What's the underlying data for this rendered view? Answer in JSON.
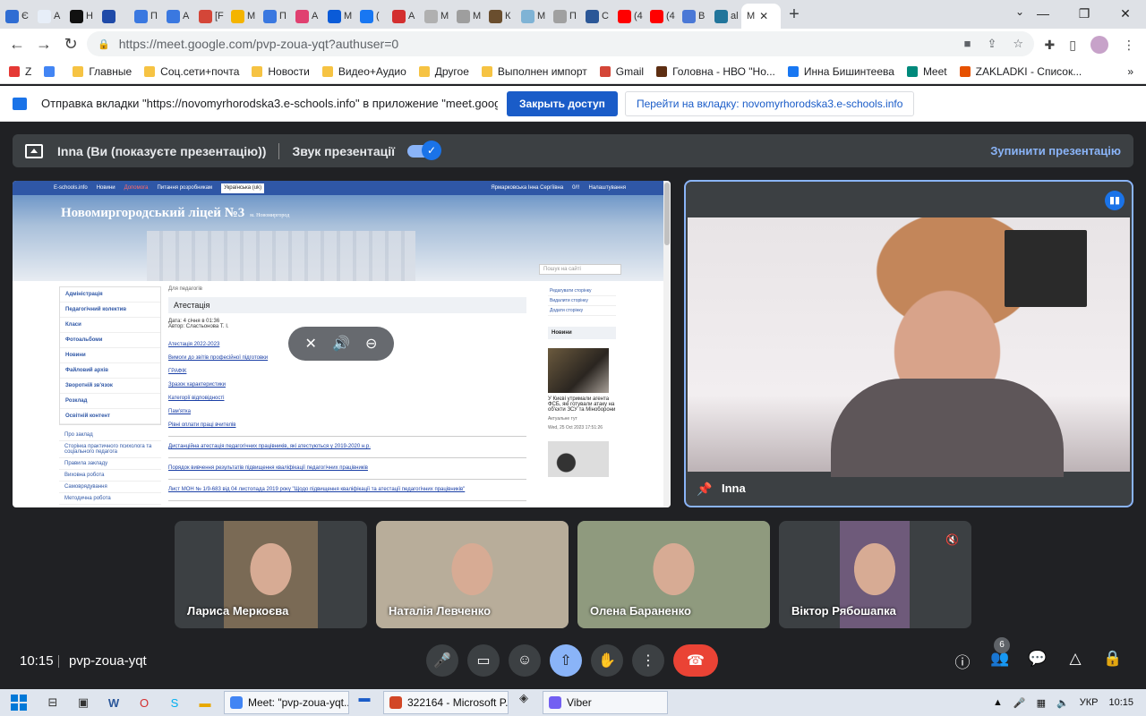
{
  "browser": {
    "tabs": [
      {
        "label": "Є",
        "color": "#2f6dd3"
      },
      {
        "label": "А",
        "color": "#e7eef8"
      },
      {
        "label": "Н",
        "color": "#111111"
      },
      {
        "label": "",
        "color": "#1f4aa8"
      },
      {
        "label": "П",
        "color": "#3a78e0"
      },
      {
        "label": "А",
        "color": "#3a78e0"
      },
      {
        "label": "[F",
        "color": "#d44638"
      },
      {
        "label": "М",
        "color": "#f4b400"
      },
      {
        "label": "П",
        "color": "#3a78e0"
      },
      {
        "label": "А",
        "color": "#e04070"
      },
      {
        "label": "М",
        "color": "#0a5bd8"
      },
      {
        "label": "(",
        "color": "#1877f2"
      },
      {
        "label": "А",
        "color": "#d32f2f"
      },
      {
        "label": "М",
        "color": "#b0b0b0"
      },
      {
        "label": "М",
        "color": "#9e9e9e"
      },
      {
        "label": "К",
        "color": "#6a4e2e"
      },
      {
        "label": "М",
        "color": "#7fb3d5"
      },
      {
        "label": "П",
        "color": "#a0a0a0"
      },
      {
        "label": "С",
        "color": "#2b5797"
      },
      {
        "label": "(4",
        "color": "#ff0000"
      },
      {
        "label": "(4",
        "color": "#ff0000"
      },
      {
        "label": "В",
        "color": "#4a78d6"
      },
      {
        "label": "al",
        "color": "#21759b"
      }
    ],
    "active_tab": {
      "label": "М"
    },
    "new_tab": "+",
    "url": "https://meet.google.com/pvp-zoua-yqt?authuser=0",
    "bookmarks": [
      {
        "label": "Z",
        "color": "#e53935"
      },
      {
        "label": "",
        "color": "#4285f4"
      },
      {
        "label": "Главные",
        "color": "#f6c343"
      },
      {
        "label": "Соц.сети+почта",
        "color": "#f6c343"
      },
      {
        "label": "Новости",
        "color": "#f6c343"
      },
      {
        "label": "Видео+Аудио",
        "color": "#f6c343"
      },
      {
        "label": "Другое",
        "color": "#f6c343"
      },
      {
        "label": "Выполнен импорт",
        "color": "#f6c343"
      },
      {
        "label": "Gmail",
        "color": "#d44638"
      },
      {
        "label": "Головна - НВО \"Но...",
        "color": "#5d2e12"
      },
      {
        "label": "Инна Бишинтеева",
        "color": "#1877f2"
      },
      {
        "label": "Meet",
        "color": "#00897b"
      },
      {
        "label": "ZAKLADKI - Список...",
        "color": "#e65100"
      }
    ],
    "more_bookmarks": "»",
    "infobar": {
      "message": "Отправка вкладки \"https://novomyrhorodska3.e-schools.info\" в приложение \"meet.google.com\"...",
      "primary": "Закрыть доступ",
      "secondary": "Перейти на вкладку: novomyrhorodska3.e-schools.info"
    }
  },
  "meet": {
    "presenter_text": "Inna (Ви (показуєте презентацію))",
    "audio_label": "Звук презентації",
    "stop_label": "Зупинити презентацію",
    "main_tile_name": "Inna",
    "participants": [
      {
        "name": "Лариса Меркоєва",
        "muted": false,
        "bg": "#7a6a55"
      },
      {
        "name": "Наталія Левченко",
        "muted": false,
        "bg": "#b8ad9a"
      },
      {
        "name": "Олена Бараненко",
        "muted": false,
        "bg": "#8f9a7e"
      },
      {
        "name": "Віктор Рябошапка",
        "muted": true,
        "bg": "#6e5a7a"
      }
    ],
    "time": "10:15",
    "meeting_code": "pvp-zoua-yqt",
    "people_count": "6"
  },
  "shared_site": {
    "topbar": {
      "brand": "E-schools.info",
      "links": [
        "Новини",
        "Допомога",
        "Питання розробникам"
      ],
      "language": "Українська (uk)",
      "user": "Ярмарковська Інна Сергіївна",
      "unread": "0/!!",
      "settings": "Налаштування"
    },
    "title": "Новомиргородський ліцей №3",
    "town": "м. Новомиргород",
    "search_placeholder": "Пошук на сайті",
    "breadcrumb": "Для педагогів",
    "page_heading": "Атестація",
    "meta_date": "Дата: 4 січня в 01:36",
    "meta_author": "Автор: Сластьонова Т. І.",
    "left_menu": [
      "Адміністрація",
      "Педагогічний колектив",
      "Класи",
      "Фотоальбоми",
      "Новини",
      "Файловий архів",
      "Зворотній зв'язок",
      "Розклад",
      "Освітній контент"
    ],
    "left_menu2": [
      "Про заклад",
      "Сторінка практичного психолога та соціального педагога",
      "Правила закладу",
      "Виховна робота",
      "Самоврядування",
      "Методична робота"
    ],
    "links": [
      "Атестація 2022-2023",
      "Вимоги до звітів професійної підготовки",
      "ГРАФІК",
      "Зразок характеристики",
      "Категорії відповідності",
      "Пам'ятка",
      "Рівні оплати праці вчителів",
      "Дистанційна атестація педагогічних працівників, які атестуються у 2019-2020 н.р.",
      "Порядок вивчення результатів підвищення кваліфікації педагогічних працівників",
      "Лист МОН № 1/9-683 від 04 листопада 2019 року \"Щодо підвищення кваліфікації та атестації педагогічних працівників\""
    ],
    "right_links": [
      "Редагувати сторінку",
      "Видалити сторінку",
      "Додати сторінку"
    ],
    "news_heading": "Новини",
    "news_text": "У Києві утримали агента ФСБ, які готували атаку на об'єкти ЗСУ та Міноборони",
    "news_tag": "Актуальне тут",
    "news_date": "Wed, 25 Oct 2023 17:51:26"
  },
  "taskbar": {
    "apps": [
      {
        "label": "Meet: \"pvp-zoua-yqt...",
        "color": "#4285f4"
      },
      {
        "label": "322164 - Microsoft P...",
        "color": "#d24726"
      },
      {
        "label": "Viber",
        "color": "#7360f2"
      }
    ],
    "lang": "УКР",
    "time": "10:15"
  }
}
